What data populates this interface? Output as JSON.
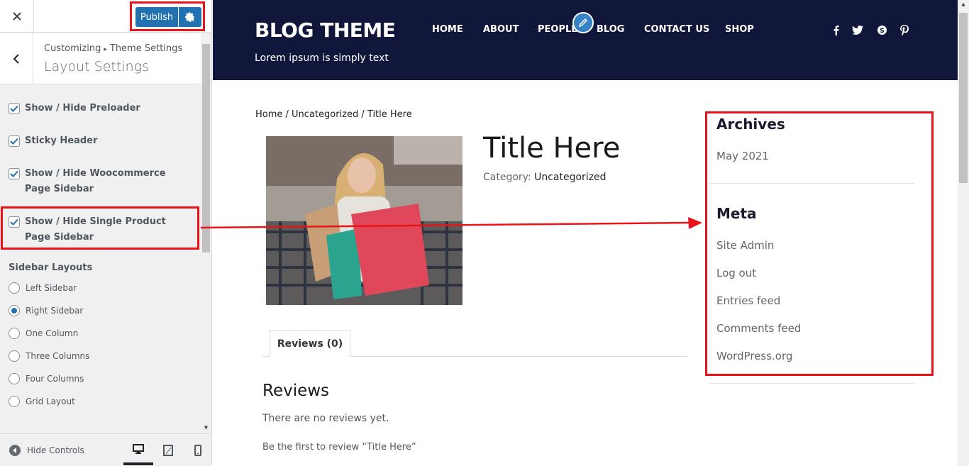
{
  "customizer": {
    "close_icon": "close-icon",
    "publish_label": "Publish",
    "breadcrumb_root": "Customizing",
    "breadcrumb_parent": "Theme Settings",
    "section_title": "Layout Settings",
    "options": [
      {
        "label": "Show / Hide Preloader",
        "checked": true
      },
      {
        "label": "Sticky Header",
        "checked": true
      },
      {
        "label": "Show / Hide Woocommerce Page Sidebar",
        "checked": true
      },
      {
        "label": "Show / Hide Single Product Page Sidebar",
        "checked": true
      }
    ],
    "sidebar_layouts_title": "Sidebar Layouts",
    "layouts": [
      {
        "label": "Left Sidebar",
        "selected": false
      },
      {
        "label": "Right Sidebar",
        "selected": true
      },
      {
        "label": "One Column",
        "selected": false
      },
      {
        "label": "Three Columns",
        "selected": false
      },
      {
        "label": "Four Columns",
        "selected": false
      },
      {
        "label": "Grid Layout",
        "selected": false
      }
    ],
    "hide_controls_label": "Hide Controls"
  },
  "preview": {
    "site_title": "BLOG THEME",
    "tagline": "Lorem ipsum is simply text",
    "nav": [
      "HOME",
      "ABOUT",
      "PEOPLE",
      "BLOG",
      "CONTACT US",
      "SHOP"
    ],
    "social": [
      "facebook-icon",
      "twitter-icon",
      "skype-icon",
      "pinterest-icon"
    ],
    "breadcrumb": {
      "home": "Home",
      "category": "Uncategorized",
      "current": "Title Here",
      "sep": " / "
    },
    "product_title": "Title Here",
    "category_label": "Category:",
    "category_value": "Uncategorized",
    "tab_label": "Reviews (0)",
    "reviews_heading": "Reviews",
    "no_reviews": "There are no reviews yet.",
    "first_review": "Be the first to review “Title Here”",
    "sidebar": {
      "archives_title": "Archives",
      "archives": [
        "May 2021"
      ],
      "meta_title": "Meta",
      "meta": [
        "Site Admin",
        "Log out",
        "Entries feed",
        "Comments feed",
        "WordPress.org"
      ]
    }
  },
  "colors": {
    "header_bg": "#11163b",
    "publish_blue": "#2271b1",
    "highlight_red": "#e8141a"
  }
}
